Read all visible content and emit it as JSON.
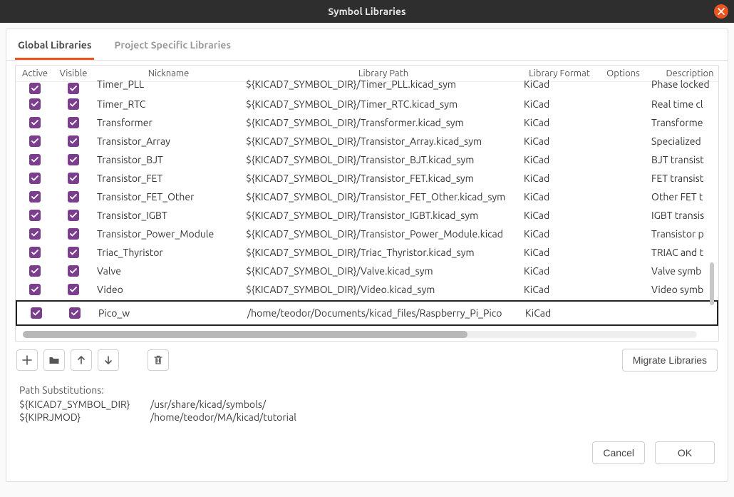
{
  "window": {
    "title": "Symbol Libraries"
  },
  "tabs": {
    "global": "Global Libraries",
    "project": "Project Specific Libraries"
  },
  "columns": {
    "active": "Active",
    "visible": "Visible",
    "nickname": "Nickname",
    "path": "Library Path",
    "format": "Library Format",
    "options": "Options",
    "description": "Description"
  },
  "rows": [
    {
      "nick": "Timer_PLL",
      "path": "${KICAD7_SYMBOL_DIR}/Timer_PLL.kicad_sym",
      "fmt": "KiCad",
      "desc": "Phase locked"
    },
    {
      "nick": "Timer_RTC",
      "path": "${KICAD7_SYMBOL_DIR}/Timer_RTC.kicad_sym",
      "fmt": "KiCad",
      "desc": "Real time cl"
    },
    {
      "nick": "Transformer",
      "path": "${KICAD7_SYMBOL_DIR}/Transformer.kicad_sym",
      "fmt": "KiCad",
      "desc": "Transforme"
    },
    {
      "nick": "Transistor_Array",
      "path": "${KICAD7_SYMBOL_DIR}/Transistor_Array.kicad_sym",
      "fmt": "KiCad",
      "desc": "Specialized"
    },
    {
      "nick": "Transistor_BJT",
      "path": "${KICAD7_SYMBOL_DIR}/Transistor_BJT.kicad_sym",
      "fmt": "KiCad",
      "desc": "BJT transist"
    },
    {
      "nick": "Transistor_FET",
      "path": "${KICAD7_SYMBOL_DIR}/Transistor_FET.kicad_sym",
      "fmt": "KiCad",
      "desc": "FET transist"
    },
    {
      "nick": "Transistor_FET_Other",
      "path": "${KICAD7_SYMBOL_DIR}/Transistor_FET_Other.kicad_sym",
      "fmt": "KiCad",
      "desc": "Other FET t"
    },
    {
      "nick": "Transistor_IGBT",
      "path": "${KICAD7_SYMBOL_DIR}/Transistor_IGBT.kicad_sym",
      "fmt": "KiCad",
      "desc": "IGBT transis"
    },
    {
      "nick": "Transistor_Power_Module",
      "path": "${KICAD7_SYMBOL_DIR}/Transistor_Power_Module.kicad",
      "fmt": "KiCad",
      "desc": "Transistor p"
    },
    {
      "nick": "Triac_Thyristor",
      "path": "${KICAD7_SYMBOL_DIR}/Triac_Thyristor.kicad_sym",
      "fmt": "KiCad",
      "desc": "TRIAC and t"
    },
    {
      "nick": "Valve",
      "path": "${KICAD7_SYMBOL_DIR}/Valve.kicad_sym",
      "fmt": "KiCad",
      "desc": "Valve symb"
    },
    {
      "nick": "Video",
      "path": "${KICAD7_SYMBOL_DIR}/Video.kicad_sym",
      "fmt": "KiCad",
      "desc": "Video symb"
    },
    {
      "nick": "Pico_w",
      "path": "/home/teodor/Documents/kicad_files/Raspberry_Pi_Pico",
      "fmt": "KiCad",
      "desc": ""
    }
  ],
  "buttons": {
    "migrate": "Migrate Libraries",
    "cancel": "Cancel",
    "ok": "OK"
  },
  "subs": {
    "title": "Path Substitutions:",
    "r0k": "${KICAD7_SYMBOL_DIR}",
    "r0v": "/usr/share/kicad/symbols/",
    "r1k": "${KIPRJMOD}",
    "r1v": "/home/teodor/MA/kicad/tutorial"
  }
}
